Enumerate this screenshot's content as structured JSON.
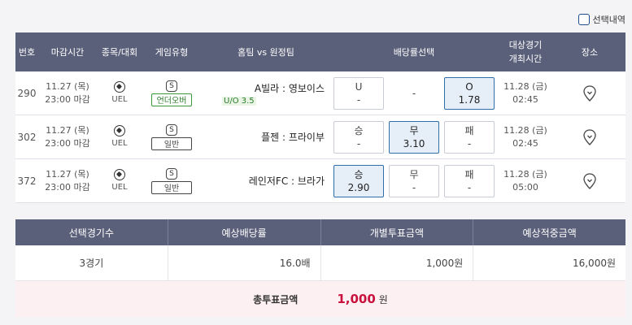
{
  "top": {
    "selection_history_label": "선택내역"
  },
  "table": {
    "headers": {
      "no": "번호",
      "deadline": "마감시간",
      "league": "종목/대회",
      "type": "게임유형",
      "match": "홈팀 vs 원정팀",
      "odds": "배당률선택",
      "game_time_line1": "대상경기",
      "game_time_line2": "개최시간",
      "place": "장소"
    },
    "rows": [
      {
        "no": "290",
        "deadline_date": "11.27 (목)",
        "deadline_time": "23:00 마감",
        "league": "UEL",
        "sport_icon": "soccer-ball-icon",
        "type_symbol": "S",
        "type_label": "언더오버",
        "match": "A빌라 : 영보이스",
        "match_sub": "U/O 3.5",
        "odds": [
          {
            "label": "U",
            "value": "-",
            "selected": false
          },
          {
            "label": "-",
            "value": "",
            "selected": false
          },
          {
            "label": "O",
            "value": "1.78",
            "selected": true
          }
        ],
        "game_date": "11.28 (금)",
        "game_time": "02:45"
      },
      {
        "no": "302",
        "deadline_date": "11.27 (목)",
        "deadline_time": "23:00 마감",
        "league": "UEL",
        "sport_icon": "soccer-ball-icon",
        "type_symbol": "S",
        "type_label": "일반",
        "match": "플젠 : 프라이부",
        "match_sub": "",
        "odds": [
          {
            "label": "승",
            "value": "-",
            "selected": false
          },
          {
            "label": "무",
            "value": "3.10",
            "selected": true
          },
          {
            "label": "패",
            "value": "-",
            "selected": false
          }
        ],
        "game_date": "11.28 (금)",
        "game_time": "02:45"
      },
      {
        "no": "372",
        "deadline_date": "11.27 (목)",
        "deadline_time": "23:00 마감",
        "league": "UEL",
        "sport_icon": "soccer-ball-icon",
        "type_symbol": "S",
        "type_label": "일반",
        "match": "레인저FC : 브라가",
        "match_sub": "",
        "odds": [
          {
            "label": "승",
            "value": "2.90",
            "selected": true
          },
          {
            "label": "무",
            "value": "-",
            "selected": false
          },
          {
            "label": "패",
            "value": "-",
            "selected": false
          }
        ],
        "game_date": "11.28 (금)",
        "game_time": "05:00"
      }
    ]
  },
  "summary": {
    "headers": [
      "선택경기수",
      "예상배당률",
      "개별투표금액",
      "예상적중금액"
    ],
    "values": [
      "3경기",
      "16.0배",
      "1,000원",
      "16,000원"
    ],
    "total_label": "총투표금액",
    "total_value": "1,000",
    "total_unit": "원"
  },
  "colors": {
    "header_bg": "#5a6079",
    "selected_bg": "#e6eff8",
    "selected_border": "#2f6ea8",
    "total_bg": "#fdf0f2",
    "total_value": "#c8113c",
    "badge_green": "#3a9a3a"
  }
}
